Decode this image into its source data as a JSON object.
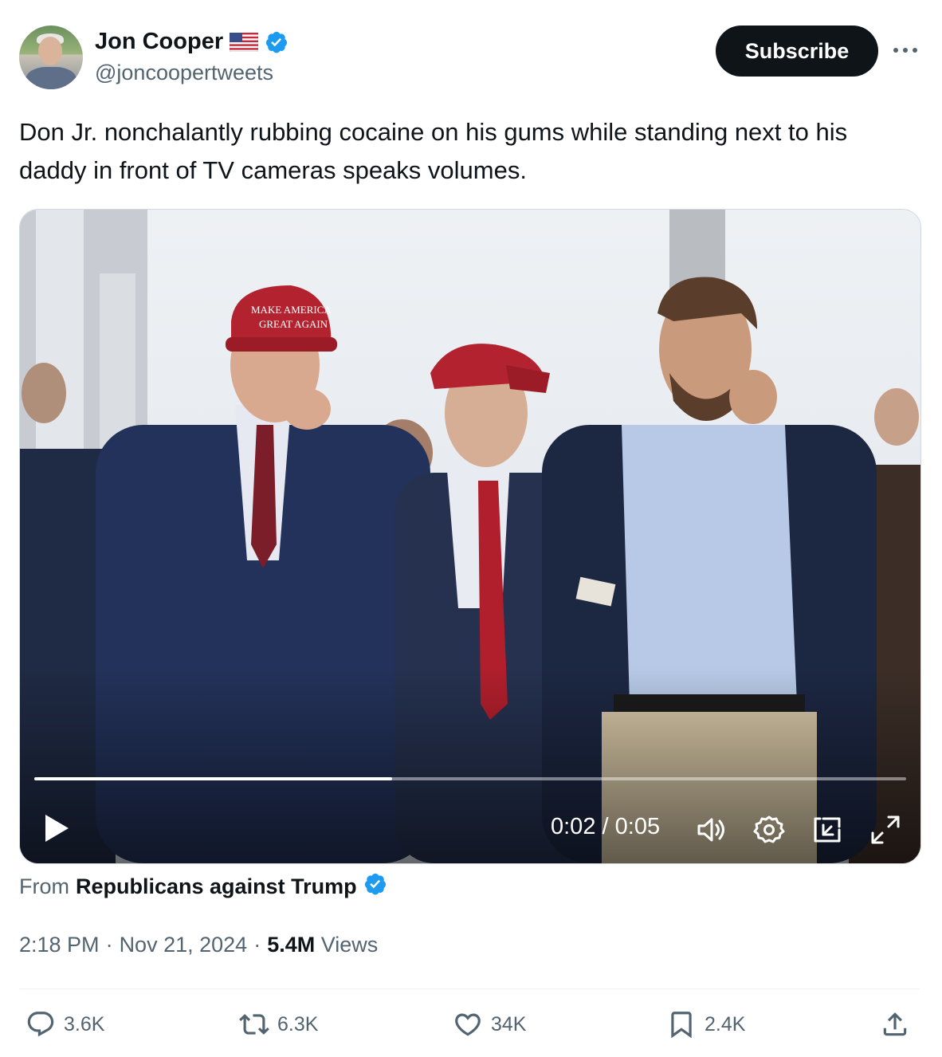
{
  "author": {
    "name": "Jon Cooper",
    "handle": "@joncoopertweets",
    "flag_icon": "us-flag-icon",
    "verified_color": "#1d9bf0"
  },
  "subscribe_label": "Subscribe",
  "tweet": {
    "text": "Don Jr. nonchalantly rubbing cocaine on his gums while standing next to his daddy in front of TV cameras speaks volumes."
  },
  "video": {
    "current_time": "0:02",
    "separator": "/",
    "duration": "0:05",
    "progress_fraction": 0.41
  },
  "source": {
    "prefix": "From",
    "name": "Republicans against Trump"
  },
  "meta": {
    "time": "2:18 PM",
    "dot": "·",
    "date": "Nov 21, 2024",
    "views_count": "5.4M",
    "views_label": "Views"
  },
  "actions": {
    "replies": "3.6K",
    "reposts": "6.3K",
    "likes": "34K",
    "bookmarks": "2.4K"
  },
  "colors": {
    "text": "#0f1419",
    "secondary": "#536471",
    "accent": "#1d9bf0"
  }
}
